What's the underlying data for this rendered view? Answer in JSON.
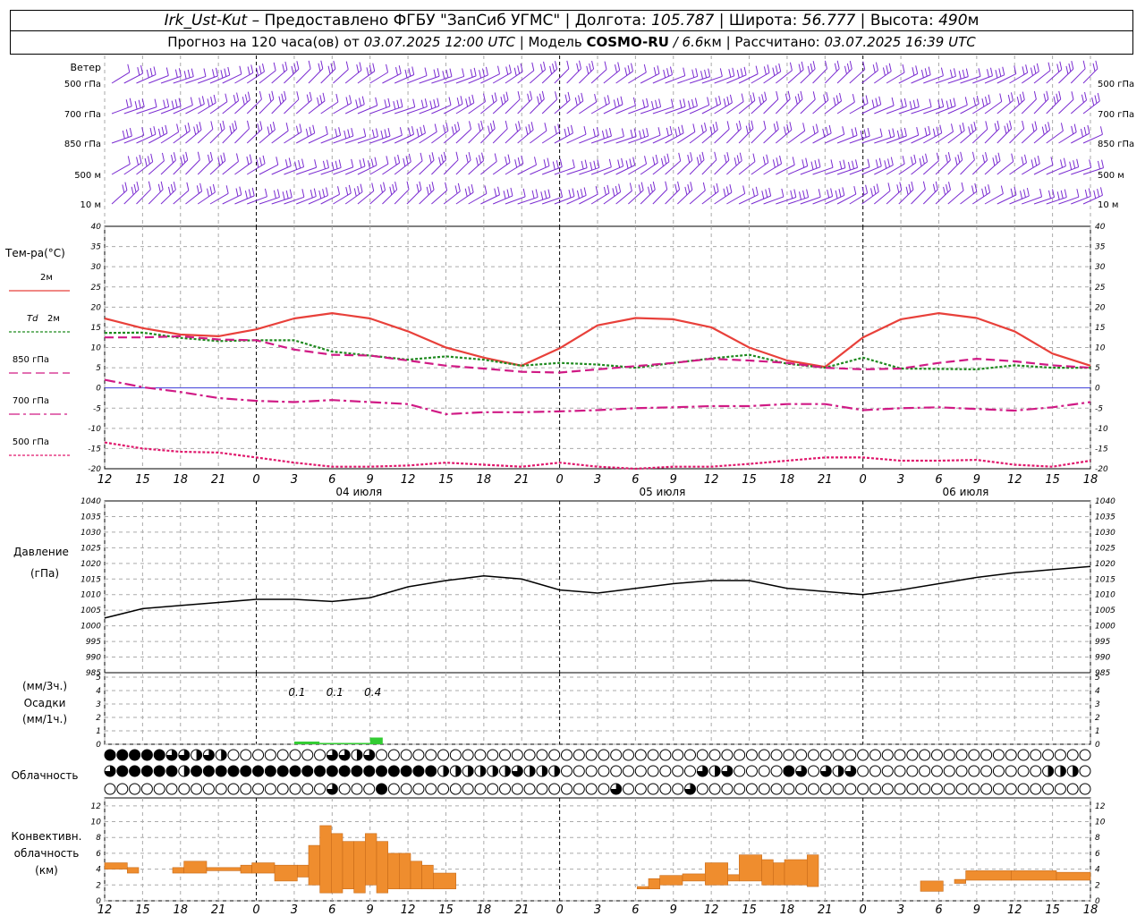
{
  "header": {
    "station": "Irk_Ust-Kut",
    "provider": " – Предоставлено ФГБУ \"ЗапСиб УГМС\" | Долгота: ",
    "lon": "105.787",
    "lat_label": " | Широта: ",
    "lat": "56.777",
    "alt_label": " | Высота: ",
    "alt": "490",
    "alt_unit": "м",
    "forecast_label": "Прогноз на 120 часа(ов) от ",
    "forecast_time": "03.07.2025 12:00 UTC",
    "model_label": " | Модель ",
    "model": "COSMO-RU",
    "res_sep": " / ",
    "res": "6.6",
    "res_unit": "км",
    "calc_label": " | Рассчитано: ",
    "calc_time": "03.07.2025 16:39 UTC"
  },
  "chart_data": {
    "hours": [
      12,
      15,
      18,
      21,
      0,
      3,
      6,
      9,
      12,
      15,
      18,
      21,
      0,
      3,
      6,
      9,
      12,
      15,
      18,
      21,
      0,
      3,
      6,
      9,
      12,
      15,
      18
    ],
    "days": [
      "04 июля",
      "05 июля",
      "06 июля"
    ],
    "wind": {
      "title": "Ветер",
      "levels": [
        "500 гПа",
        "700 гПа",
        "850 гПа",
        "500 м",
        "10  м"
      ]
    },
    "temp": {
      "type": "line",
      "title": "Тем-ра(°C)",
      "ylim": [
        -20,
        40
      ],
      "ticks": [
        -20,
        -15,
        -10,
        -5,
        0,
        5,
        10,
        15,
        20,
        25,
        30,
        35,
        40
      ],
      "series": [
        {
          "name": "2м",
          "color": "#e8403a",
          "dash": "",
          "width": 2.2,
          "values": [
            17.2,
            14.8,
            13.2,
            12.8,
            14.5,
            17.2,
            18.5,
            17.2,
            14,
            10,
            7.5,
            5.5,
            9.8,
            15.5,
            17.3,
            17,
            15,
            10,
            6.8,
            5.2,
            12.5,
            17,
            18.5,
            17.3,
            14,
            8.5,
            5.5
          ]
        },
        {
          "name": "Td  2м",
          "color": "#1f8a1f",
          "dash": "3,2",
          "width": 2.2,
          "values": [
            13.6,
            13.7,
            12.4,
            11.6,
            11.8,
            11.8,
            9,
            8,
            7,
            7.8,
            7,
            5.5,
            6.2,
            5.8,
            5,
            6.2,
            7.3,
            8.2,
            6,
            5,
            7.5,
            4.8,
            4.7,
            4.6,
            5.6,
            5,
            5
          ]
        },
        {
          "name": "850 гПа",
          "color": "#d01a85",
          "dash": "10,5",
          "width": 2.2,
          "values": [
            12.5,
            12.5,
            12.8,
            12,
            11.8,
            9.5,
            8.2,
            8,
            6.8,
            5.5,
            4.8,
            4,
            3.8,
            4.6,
            5.4,
            6.2,
            7.2,
            6.8,
            6.2,
            5,
            4.6,
            4.8,
            6.2,
            7.2,
            6.6,
            5.6,
            5
          ]
        },
        {
          "name": "700 гПа",
          "color": "#d01a85",
          "dash": "12,4,3,4",
          "width": 2.2,
          "values": [
            2,
            0.2,
            -1,
            -2.5,
            -3.2,
            -3.5,
            -3,
            -3.5,
            -4,
            -6.5,
            -6,
            -6,
            -5.8,
            -5.5,
            -5,
            -4.8,
            -4.5,
            -4.5,
            -4,
            -4,
            -5.5,
            -5,
            -4.8,
            -5.2,
            -5.6,
            -4.8,
            -3.5
          ]
        },
        {
          "name": "500 гПа",
          "color": "#e0186c",
          "dash": "3,2",
          "width": 2.2,
          "values": [
            -13.5,
            -15,
            -15.8,
            -16,
            -17.2,
            -18.5,
            -19.5,
            -19.5,
            -19.2,
            -18.5,
            -19,
            -19.5,
            -18.5,
            -19.5,
            -20,
            -19.5,
            -19.5,
            -18.8,
            -18,
            -17.2,
            -17.2,
            -18,
            -18,
            -17.8,
            -19,
            -19.5,
            -18
          ]
        }
      ]
    },
    "pressure": {
      "type": "line",
      "title": "Давление",
      "unit": "(гПа)",
      "ylim": [
        985,
        1040
      ],
      "ticks": [
        985,
        990,
        995,
        1000,
        1005,
        1010,
        1015,
        1020,
        1025,
        1030,
        1035,
        1040
      ],
      "values": [
        1002.5,
        1005.5,
        1006.5,
        1007.5,
        1008.5,
        1008.5,
        1007.8,
        1009,
        1012.5,
        1014.5,
        1016,
        1015,
        1011.5,
        1010.5,
        1012,
        1013.5,
        1014.5,
        1014.5,
        1012,
        1011,
        1010,
        1011.5,
        1013.5,
        1015.5,
        1017,
        1018,
        1019
      ]
    },
    "precip": {
      "type": "bar",
      "title": "Осадки",
      "unit_top": "(мм/3ч.)",
      "unit_bottom": "(мм/1ч.)",
      "ylim": [
        0,
        5
      ],
      "ticks": [
        0,
        1,
        2,
        3,
        4,
        5
      ],
      "labels": [
        {
          "hour_index": 5,
          "value": "0.1"
        },
        {
          "hour_index": 6,
          "value": "0.1"
        },
        {
          "hour_index": 7,
          "value": "0.4"
        }
      ],
      "bars": [
        {
          "start": 15,
          "end": 17,
          "value": 0.2
        },
        {
          "start": 17,
          "end": 19,
          "value": 0.1
        },
        {
          "start": 19,
          "end": 21,
          "value": 0.1
        },
        {
          "start": 21,
          "end": 22,
          "value": 0.5
        }
      ]
    },
    "cloud": {
      "title": "Облачность",
      "rows": [
        "44444332320000000033230000000000000000000000000000000000000000000000000000000000000000000000000000000040000000000000000000000000000000",
        "34444424444444444444444444422222232220000000000032300004303230000000000000002220002222400000000000000000000000000000000000000000000000",
        "00000000000000000030004000000000000000000300000300000000000000000000000000000000000000000000000000000000000000000000000000000000000000"
      ]
    },
    "convective": {
      "type": "bar",
      "title": "Конвективн.",
      "title2": "облачность",
      "unit": "(км)",
      "ylim": [
        0,
        13
      ],
      "ticks": [
        0,
        2,
        4,
        6,
        8,
        10,
        12
      ],
      "color": "#ef8d2e",
      "bars": [
        {
          "start": 0,
          "end": 2,
          "bottom": 4,
          "top": 4.8
        },
        {
          "start": 2,
          "end": 3,
          "bottom": 3.5,
          "top": 4.2
        },
        {
          "start": 6,
          "end": 7,
          "bottom": 3.5,
          "top": 4.2
        },
        {
          "start": 7,
          "end": 9,
          "bottom": 3.5,
          "top": 5
        },
        {
          "start": 9,
          "end": 12,
          "bottom": 3.8,
          "top": 4.2
        },
        {
          "start": 12,
          "end": 13,
          "bottom": 3.5,
          "top": 4.5
        },
        {
          "start": 13,
          "end": 15,
          "bottom": 3.5,
          "top": 4.8
        },
        {
          "start": 15,
          "end": 17,
          "bottom": 2.5,
          "top": 4.5
        },
        {
          "start": 17,
          "end": 18,
          "bottom": 3,
          "top": 4.5
        },
        {
          "start": 18,
          "end": 19,
          "bottom": 2,
          "top": 7
        },
        {
          "start": 19,
          "end": 20,
          "bottom": 1,
          "top": 9.5
        },
        {
          "start": 20,
          "end": 21,
          "bottom": 1,
          "top": 8.5
        },
        {
          "start": 21,
          "end": 22,
          "bottom": 1.5,
          "top": 7.5
        },
        {
          "start": 22,
          "end": 23,
          "bottom": 1,
          "top": 7.5
        },
        {
          "start": 23,
          "end": 24,
          "bottom": 2,
          "top": 8.5
        },
        {
          "start": 24,
          "end": 25,
          "bottom": 1,
          "top": 7.5
        },
        {
          "start": 25,
          "end": 26,
          "bottom": 1.5,
          "top": 6
        },
        {
          "start": 26,
          "end": 27,
          "bottom": 1.5,
          "top": 6
        },
        {
          "start": 27,
          "end": 28,
          "bottom": 1.5,
          "top": 5
        },
        {
          "start": 28,
          "end": 29,
          "bottom": 1.5,
          "top": 4.5
        },
        {
          "start": 29,
          "end": 31,
          "bottom": 1.5,
          "top": 3.5
        },
        {
          "start": 47,
          "end": 48,
          "bottom": 1.5,
          "top": 1.8
        },
        {
          "start": 48,
          "end": 49,
          "bottom": 1.5,
          "top": 2.8
        },
        {
          "start": 49,
          "end": 51,
          "bottom": 2,
          "top": 3.2
        },
        {
          "start": 51,
          "end": 53,
          "bottom": 2.5,
          "top": 3.4
        },
        {
          "start": 53,
          "end": 55,
          "bottom": 2,
          "top": 4.8
        },
        {
          "start": 55,
          "end": 56,
          "bottom": 2.5,
          "top": 3.3
        },
        {
          "start": 56,
          "end": 58,
          "bottom": 2.5,
          "top": 5.8
        },
        {
          "start": 58,
          "end": 59,
          "bottom": 2,
          "top": 5.2
        },
        {
          "start": 59,
          "end": 60,
          "bottom": 2,
          "top": 4.8
        },
        {
          "start": 60,
          "end": 62,
          "bottom": 2,
          "top": 5.2
        },
        {
          "start": 62,
          "end": 63,
          "bottom": 1.8,
          "top": 5.8
        },
        {
          "start": 72,
          "end": 74,
          "bottom": 1.2,
          "top": 2.5
        },
        {
          "start": 75,
          "end": 76,
          "bottom": 2.2,
          "top": 2.7
        },
        {
          "start": 76,
          "end": 80,
          "bottom": 2.6,
          "top": 3.8
        },
        {
          "start": 80,
          "end": 84,
          "bottom": 2.6,
          "top": 3.8
        },
        {
          "start": 84,
          "end": 87,
          "bottom": 2.6,
          "top": 3.6
        }
      ]
    }
  }
}
